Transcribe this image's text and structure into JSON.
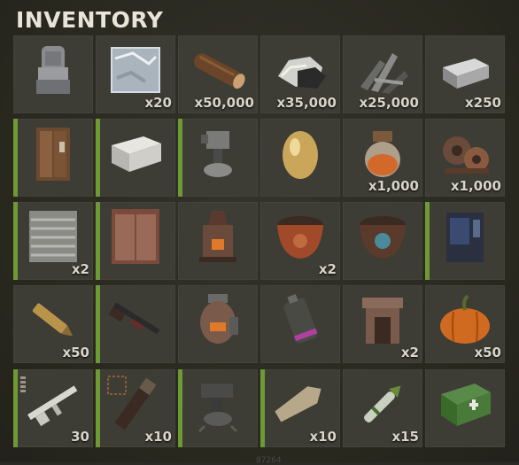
{
  "title": "INVENTORY",
  "inventory": [
    {
      "icon": "stone-throne-icon",
      "qty": "",
      "bar": false
    },
    {
      "icon": "metal-fragments-block-icon",
      "qty": "x20",
      "bar": false
    },
    {
      "icon": "wood-log-icon",
      "qty": "x50,000",
      "bar": false
    },
    {
      "icon": "stone-ore-icon",
      "qty": "x35,000",
      "bar": false
    },
    {
      "icon": "metal-scrap-pile-icon",
      "qty": "x25,000",
      "bar": false
    },
    {
      "icon": "metal-ingot-icon",
      "qty": "x250",
      "bar": false
    },
    {
      "icon": "wooden-locker-icon",
      "qty": "",
      "bar": true
    },
    {
      "icon": "white-box-icon",
      "qty": "",
      "bar": true
    },
    {
      "icon": "auto-turret-icon",
      "qty": "",
      "bar": true
    },
    {
      "icon": "golden-egg-icon",
      "qty": "",
      "bar": false
    },
    {
      "icon": "low-grade-fuel-jar-icon",
      "qty": "x1,000",
      "bar": false
    },
    {
      "icon": "gears-icon",
      "qty": "x1,000",
      "bar": false
    },
    {
      "icon": "garage-door-icon",
      "qty": "x2",
      "bar": true
    },
    {
      "icon": "double-door-icon",
      "qty": "",
      "bar": true
    },
    {
      "icon": "furnace-icon",
      "qty": "",
      "bar": false
    },
    {
      "icon": "red-planter-pot-icon",
      "qty": "x2",
      "bar": false
    },
    {
      "icon": "blue-planter-pot-icon",
      "qty": "",
      "bar": false
    },
    {
      "icon": "vending-machine-icon",
      "qty": "",
      "bar": true
    },
    {
      "icon": "rifle-ammo-icon",
      "qty": "x50",
      "bar": false
    },
    {
      "icon": "pump-shotgun-icon",
      "qty": "",
      "bar": true
    },
    {
      "icon": "oil-refinery-icon",
      "qty": "",
      "bar": false
    },
    {
      "icon": "smoke-grenade-icon",
      "qty": "",
      "bar": false
    },
    {
      "icon": "fireplace-icon",
      "qty": "x2",
      "bar": false
    },
    {
      "icon": "pumpkin-icon",
      "qty": "x50",
      "bar": false
    }
  ],
  "hotbar": [
    {
      "icon": "assault-rifle-icon",
      "qty": "30",
      "bar": true,
      "cond": true
    },
    {
      "icon": "rocket-launcher-icon",
      "qty": "x10",
      "bar": true,
      "cond": false
    },
    {
      "icon": "sam-turret-icon",
      "qty": "",
      "bar": true,
      "cond": false
    },
    {
      "icon": "wooden-coffin-icon",
      "qty": "x10",
      "bar": true,
      "cond": false
    },
    {
      "icon": "rocket-ammo-icon",
      "qty": "x15",
      "bar": false,
      "cond": false
    },
    {
      "icon": "medical-crate-icon",
      "qty": "",
      "bar": false,
      "cond": false
    }
  ],
  "footer_code": "87264"
}
